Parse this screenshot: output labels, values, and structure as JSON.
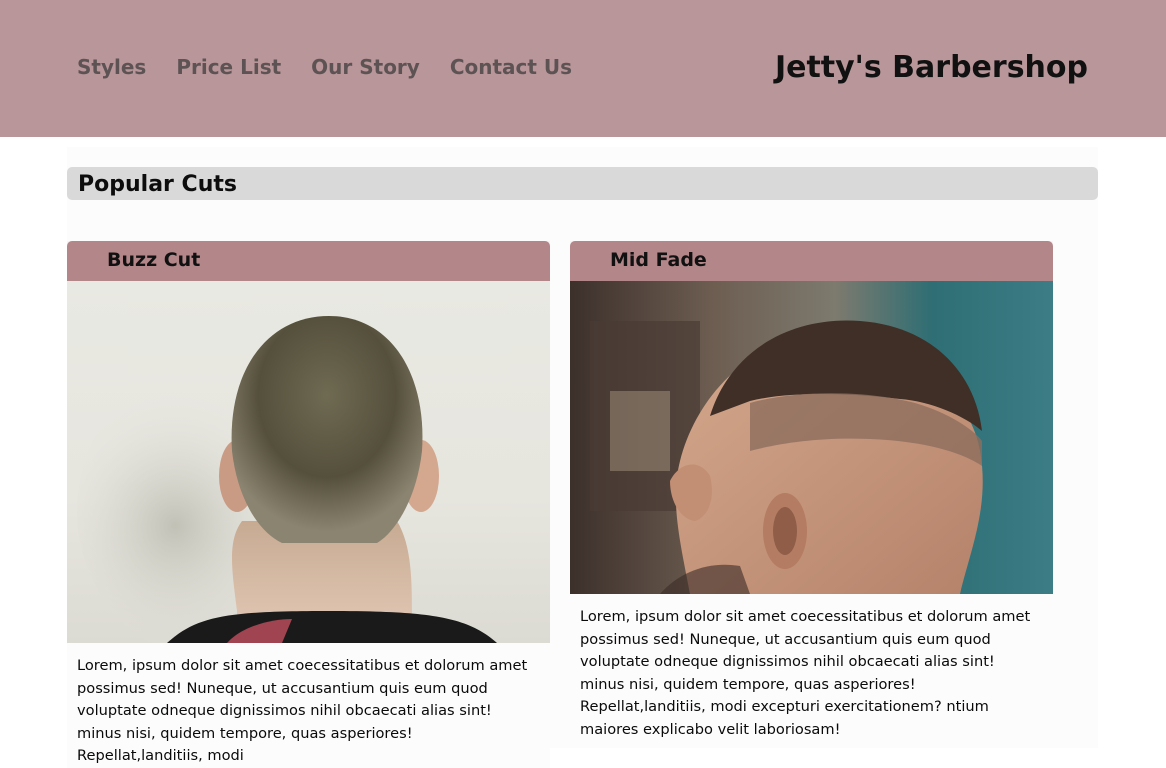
{
  "header": {
    "nav": [
      "Styles",
      "Price List",
      "Our Story",
      "Contact Us"
    ],
    "brand": "Jetty's Barbershop"
  },
  "section": {
    "title": "Popular Cuts"
  },
  "cards": [
    {
      "title": "Buzz Cut",
      "image": "buzz-cut-photo",
      "text": "Lorem, ipsum dolor sit amet coecessitatibus et dolorum amet possimus sed! Nuneque, ut accusantium quis eum quod voluptate odneque dignissimos nihil obcaecati alias sint! minus nisi, quidem tempore, quas asperiores! Repellat,landitiis, modi"
    },
    {
      "title": "Mid Fade",
      "image": "mid-fade-photo",
      "text": "Lorem, ipsum dolor sit amet coecessitatibus et dolorum amet possimus sed! Nuneque, ut accusantium quis eum quod voluptate odneque dignissimos nihil obcaecati alias sint! minus nisi, quidem tempore, quas asperiores! Repellat,landitiis, modi excepturi exercitationem? ntium maiores explicabo velit laboriosam!"
    }
  ],
  "colors": {
    "header_bg": "#b99699",
    "card_head_bg": "#b38689",
    "section_bar_bg": "#d9d9d9"
  }
}
